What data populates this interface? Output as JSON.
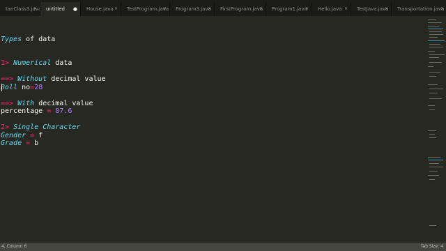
{
  "tabs": [
    {
      "label": "tanClass3.java",
      "active": false
    },
    {
      "label": "untitled",
      "active": true
    },
    {
      "label": "House.java",
      "active": false
    },
    {
      "label": "TestProgram.java",
      "active": false
    },
    {
      "label": "Program3.java",
      "active": false
    },
    {
      "label": "FirstProgram.java",
      "active": false
    },
    {
      "label": "Program1.java",
      "active": false
    },
    {
      "label": "Hello.java",
      "active": false
    },
    {
      "label": "TestJava.java",
      "active": false
    },
    {
      "label": "Transportation.java",
      "active": false
    }
  ],
  "close_glyph": "×",
  "active_dot": "●",
  "editor": {
    "heading": {
      "word": "Types",
      "rest": " of data"
    },
    "numerical": {
      "prefix": "1>",
      "word": "Numerical",
      "rest": " data"
    },
    "without": {
      "arrow": "==>",
      "word": " Without",
      "rest": " decimal value"
    },
    "roll": {
      "word": "Roll",
      "rest": " no",
      "op": "=",
      "value": "28"
    },
    "with": {
      "arrow": "==>",
      "word": " With",
      "rest": " decimal value"
    },
    "percentage": {
      "word": "percentage ",
      "op": "=",
      "value": " 87.6"
    },
    "single": {
      "prefix": "2>",
      "word": " Single Character"
    },
    "gender": {
      "word": "Gender",
      "op": " =",
      "value": " f"
    },
    "grade": {
      "word": "Grade",
      "op": " =",
      "value": " b"
    }
  },
  "status": {
    "position": "4, Column 6",
    "tab_size": "Tab Size: 4"
  },
  "colors": {
    "background": "#272822",
    "keyword_pink": "#f92672",
    "italic_cyan": "#66d9ef",
    "number_purple": "#ae81ff",
    "text": "#f8f8f2"
  }
}
